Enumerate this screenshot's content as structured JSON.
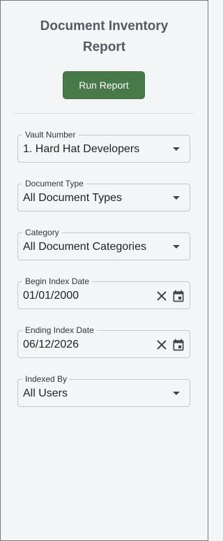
{
  "report": {
    "title_line1": "Document Inventory",
    "title_line2": "Report",
    "run_label": "Run Report"
  },
  "fields": {
    "vault": {
      "label": "Vault Number",
      "value": "1. Hard Hat Developers"
    },
    "doc_type": {
      "label": "Document Type",
      "value": "All Document Types"
    },
    "category": {
      "label": "Category",
      "value": "All Document Categories"
    },
    "begin_date": {
      "label": "Begin Index Date",
      "value": "01/01/2000"
    },
    "end_date": {
      "label": "Ending Index Date",
      "value": "06/12/2026"
    },
    "indexed_by": {
      "label": "Indexed By",
      "value": "All Users"
    }
  },
  "icons": {
    "dropdown": "chevron-down-icon",
    "clear": "close-icon",
    "calendar": "calendar-icon"
  },
  "colors": {
    "accent": "#477a48",
    "title": "#555a62",
    "background": "#f4f5f7"
  }
}
